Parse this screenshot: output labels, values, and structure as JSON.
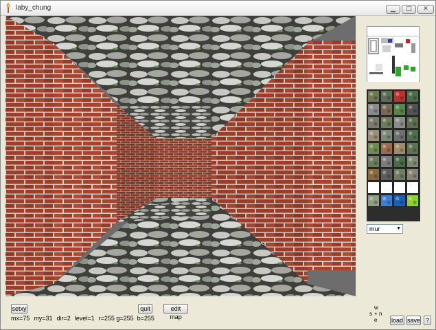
{
  "window": {
    "title": "laby_chung",
    "minimize_glyph": "▁",
    "maximize_glyph": "□",
    "close_glyph": "✕"
  },
  "viewport": {
    "scene": "first-person maze corridor with brick walls and stone floor/ceiling"
  },
  "palette": {
    "tiles": [
      "#6f7a55",
      "#5d6e58",
      "#b8332e",
      "#4c6e4a",
      "#8b8b8b",
      "#7a6a55",
      "#598448",
      "#525252",
      "#7a7a6e",
      "#6d7a5e",
      "#8a8d86",
      "#5c6c4e",
      "#9a8f7a",
      "#7d8876",
      "#6f6f6f",
      "#4f6f4a",
      "#6e8a54",
      "#9a6b4f",
      "#a08a6a",
      "#5d7453",
      "#6a7d5b",
      "#7c7c7c",
      "#496c46",
      "#808a70",
      "#8a6a3c",
      "#5d5d5d",
      "#6e7c60",
      "#8b8378",
      "#ffffff",
      "#ffffff",
      "#ffffff",
      "#ffffff",
      "#8e9d86",
      "#3c7fd0",
      "#1c5fb7",
      "#8ad22e"
    ]
  },
  "select": {
    "value": "mur"
  },
  "buttons": {
    "setxy": "setxy",
    "quit": "quit",
    "edit_map": "edit map",
    "load": "load",
    "save": "save",
    "help": "?"
  },
  "status": {
    "mx": "mx=75",
    "my": "my=31",
    "dir": "dir=2",
    "level": "level=1",
    "rgb": "r=255 g=255  b=255"
  },
  "compass": {
    "w": "w",
    "s": "s",
    "plus": "+",
    "n": "n",
    "e": "e"
  }
}
